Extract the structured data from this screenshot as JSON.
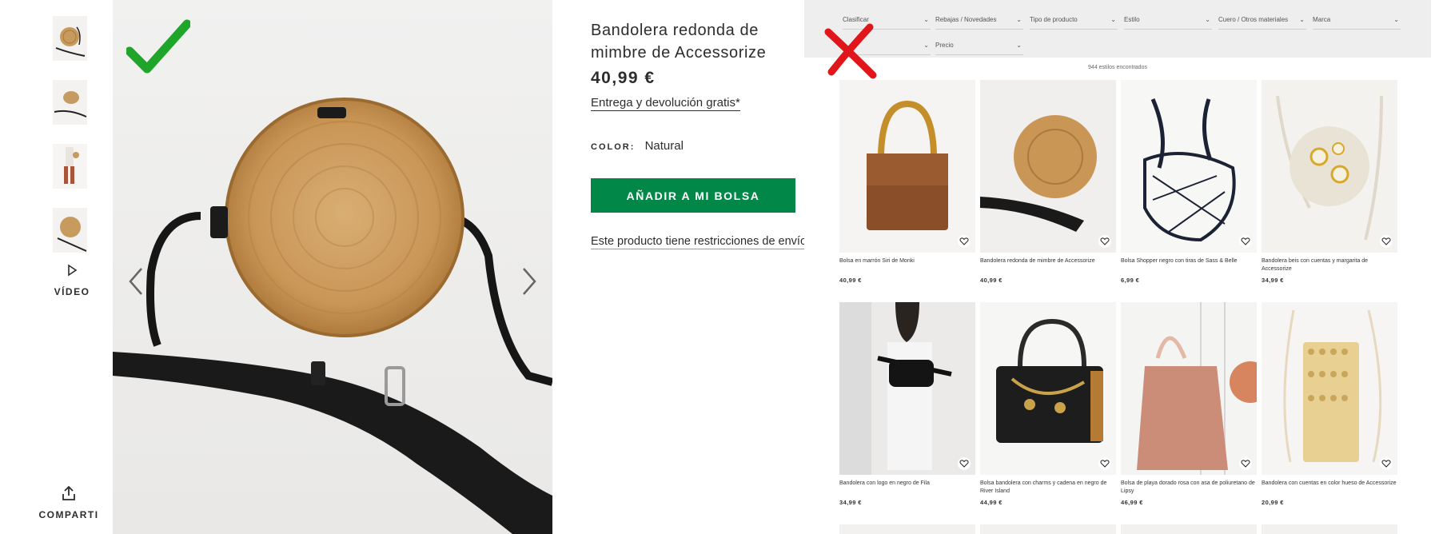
{
  "gallery": {
    "thumbnails": [
      "thumbnail-1",
      "thumbnail-2",
      "thumbnail-3",
      "thumbnail-4"
    ],
    "video_label": "VÍDEO",
    "share_label": "COMPARTI"
  },
  "product": {
    "title": "Bandolera redonda de mimbre de Accessorize",
    "price": "40,99 €",
    "delivery_link": "Entrega y devolución gratis*",
    "color_key": "COLOR:",
    "color_value": "Natural",
    "add_button": "AÑADIR A MI BOLSA",
    "restriction_link": "Este producto tiene restricciones de envío."
  },
  "listing": {
    "filters": [
      {
        "label": "Clasificar"
      },
      {
        "label": "Rebajas / Novedades"
      },
      {
        "label": "Tipo de producto"
      },
      {
        "label": "Estilo"
      },
      {
        "label": "Cuero / Otros materiales"
      },
      {
        "label": "Marca"
      },
      {
        "label": ""
      },
      {
        "label": "Precio"
      }
    ],
    "found_text": "944 estilos encontrados",
    "products": [
      {
        "name": "Bolsa en marrón Siri de Monki",
        "price": "40,99 €",
        "image": "brown-woven-handbag"
      },
      {
        "name": "Bandolera redonda de mimbre de Accessorize",
        "price": "40,99 €",
        "image": "round-wicker-bag"
      },
      {
        "name": "Bolsa Shopper negro con tiras de Sass & Belle",
        "price": "6,99 €",
        "image": "black-net-bag"
      },
      {
        "name": "Bandolera beis con cuentas y margarita de Accessorize",
        "price": "34,99 €",
        "image": "daisy-round-bag"
      },
      {
        "name": "Bandolera con logo en negro de Fila",
        "price": "34,99 €",
        "image": "fila-belt-bag"
      },
      {
        "name": "Bolsa bandolera con charms y cadena en negro de River Island",
        "price": "44,99 €",
        "image": "black-chain-bag"
      },
      {
        "name": "Bolsa de playa dorado rosa con asa de poliuretano de Lipsy",
        "price": "46,99 €",
        "image": "pink-beach-tote"
      },
      {
        "name": "Bandolera con cuentas en color hueso de Accessorize",
        "price": "20,99 €",
        "image": "beaded-phone-bag"
      }
    ]
  },
  "colors": {
    "add_button": "#018849",
    "check_mark": "#1ea52a",
    "cross_mark": "#e0161a"
  }
}
